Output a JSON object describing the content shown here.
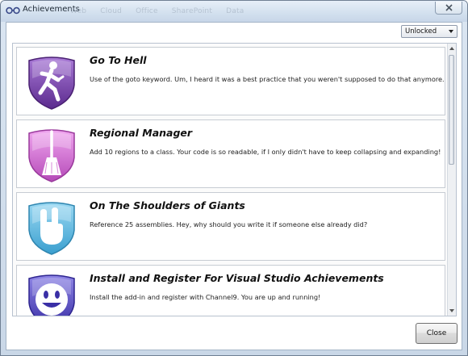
{
  "window": {
    "title": "Achievements",
    "background_tabs": [
      "Web",
      "Cloud",
      "Office",
      "SharePoint",
      "Data"
    ]
  },
  "filter": {
    "selected": "Unlocked"
  },
  "achievements": [
    {
      "title": "Go To Hell",
      "description": "Use of the goto keyword. Um, I heard it was a best practice that you weren't supposed to do that anymore.",
      "icon": "running-figure-icon",
      "color": "#7b3fb0"
    },
    {
      "title": "Regional Manager",
      "description": "Add 10 regions to a class. Your code is so readable, if I only didn't have to keep collapsing and expanding!",
      "icon": "broom-icon",
      "color": "#cf5fcf"
    },
    {
      "title": "On The Shoulders of Giants",
      "description": "Reference 25 assemblies. Hey, why should you write it if someone else already did?",
      "icon": "rock-hand-icon",
      "color": "#4db3dc"
    },
    {
      "title": "Install and Register For Visual Studio Achievements",
      "description": "Install the add-in and register with Channel9. You are up and running!",
      "icon": "smiley-face-icon",
      "color": "#4b3fc0"
    }
  ],
  "footer": {
    "close_label": "Close"
  },
  "colors": {
    "titlebar": "#d4e1ef",
    "window_border": "#6f7f93"
  }
}
